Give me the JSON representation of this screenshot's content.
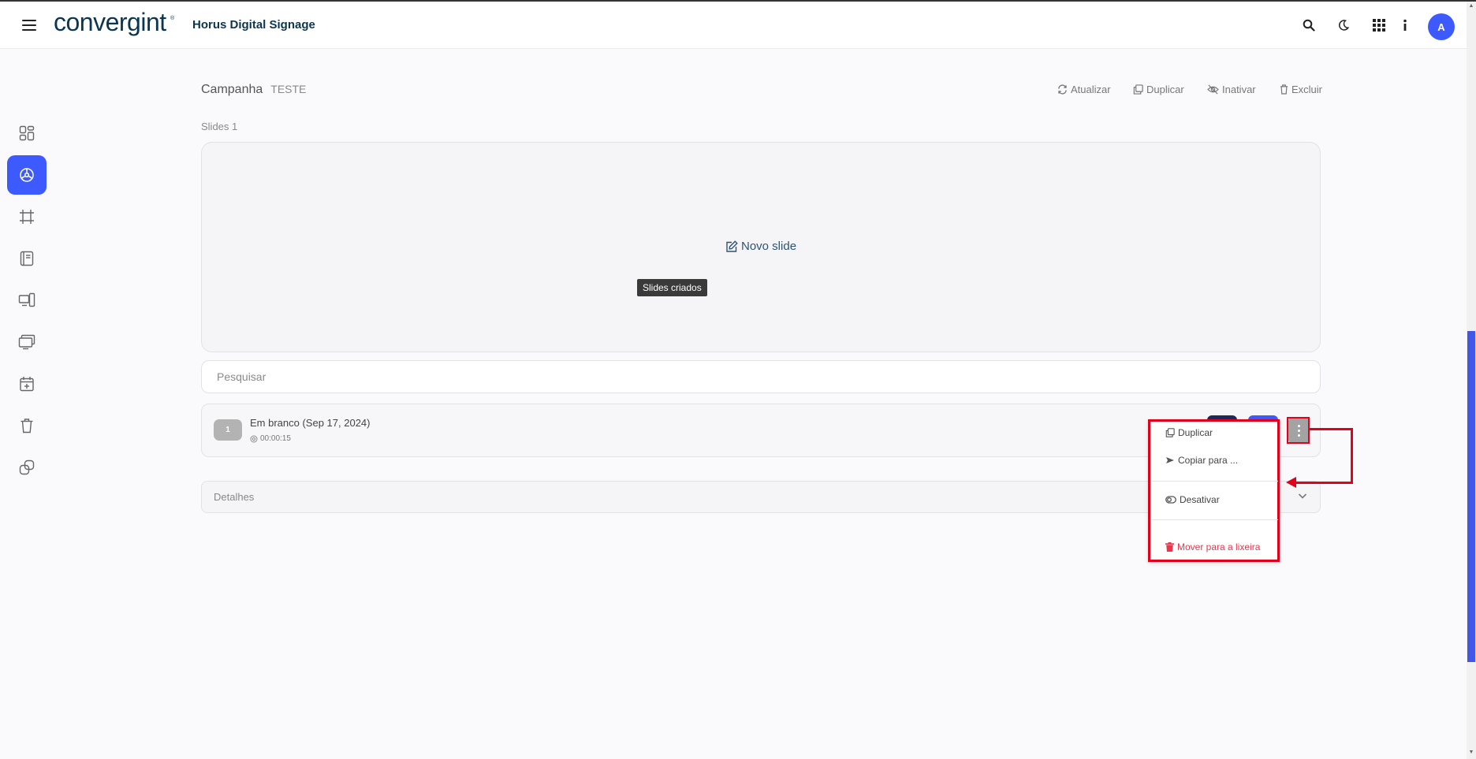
{
  "header": {
    "logo_text": "convergint",
    "logo_mark": "®",
    "app_title": "Horus Digital Signage",
    "avatar_initial": "A",
    "icons": [
      "menu-icon",
      "search-icon",
      "moon-icon",
      "apps-grid-icon",
      "info-icon"
    ]
  },
  "sidebar": {
    "items": [
      {
        "icon": "dashboard-icon"
      },
      {
        "icon": "campaign-icon",
        "active": true
      },
      {
        "icon": "crop-icon"
      },
      {
        "icon": "content-icon"
      },
      {
        "icon": "devices-icon"
      },
      {
        "icon": "screens-icon"
      },
      {
        "icon": "calendar-add-icon"
      },
      {
        "icon": "trash-icon"
      },
      {
        "icon": "link-icon"
      }
    ]
  },
  "campaign": {
    "label": "Campanha",
    "name": "TESTE",
    "actions": {
      "refresh": "Atualizar",
      "duplicate": "Duplicar",
      "deactivate": "Inativar",
      "delete": "Excluir"
    }
  },
  "slides": {
    "count_label": "Slides 1",
    "new_slide": "Novo slide",
    "tooltip": "Slides criados",
    "search_placeholder": "Pesquisar",
    "items": [
      {
        "number": "1",
        "name": "Em branco (Sep 17, 2024)",
        "duration": "00:00:15"
      }
    ]
  },
  "details": {
    "label": "Detalhes"
  },
  "dropdown_menu": {
    "duplicate": "Duplicar",
    "copy_to": "Copiar para ...",
    "deactivate": "Desativar",
    "move_to_trash": "Mover para a lixeira"
  },
  "colors": {
    "accent": "#3d5afe",
    "brand": "#0c3550",
    "highlight": "#e3001b",
    "danger": "#e53950"
  }
}
